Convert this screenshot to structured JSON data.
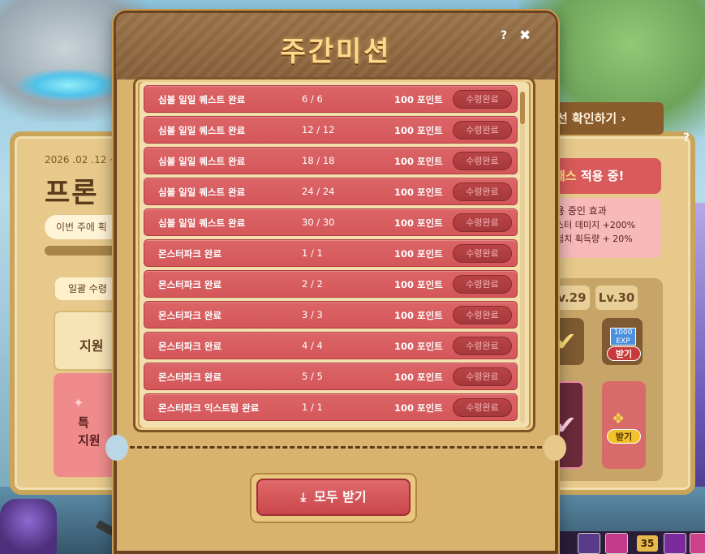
{
  "background": {
    "date": "2026 .02 .12 ~ 2",
    "title": "프론",
    "subtitle": "이번 주에 획",
    "tab_label": "일괄 수령",
    "card1": "지원 ",
    "card2_line1": "특",
    "card2_line2": "지원 ",
    "right_link": "선 확인하기 ›",
    "pass_highlight": "패스",
    "pass_rest": " 적용 중!",
    "effect_title": "용 중인 효과",
    "effect_line1": "스터 데미지 +200%",
    "effect_line2": "험치 획득량 + 20%",
    "lv29": "v.29",
    "lv30": "Lv.30",
    "exp_amount": "1000",
    "exp_label": "EXP",
    "get_label": "받기",
    "hud_level": "35",
    "help": "?"
  },
  "modal": {
    "title": "주간미션",
    "help_icon": "?",
    "close_icon": "✖",
    "claim_all_label": "모두 받기",
    "missions": [
      {
        "name": "심볼 일일 퀘스트 완료",
        "progress": "6 / 6",
        "points": "100 포인트",
        "status": "수령완료"
      },
      {
        "name": "심볼 일일 퀘스트 완료",
        "progress": "12 / 12",
        "points": "100 포인트",
        "status": "수령완료"
      },
      {
        "name": "심볼 일일 퀘스트 완료",
        "progress": "18 / 18",
        "points": "100 포인트",
        "status": "수령완료"
      },
      {
        "name": "심볼 일일 퀘스트 완료",
        "progress": "24 / 24",
        "points": "100 포인트",
        "status": "수령완료"
      },
      {
        "name": "심볼 일일 퀘스트 완료",
        "progress": "30 / 30",
        "points": "100 포인트",
        "status": "수령완료"
      },
      {
        "name": "몬스터파크 완료",
        "progress": "1 / 1",
        "points": "100 포인트",
        "status": "수령완료"
      },
      {
        "name": "몬스터파크 완료",
        "progress": "2 / 2",
        "points": "100 포인트",
        "status": "수령완료"
      },
      {
        "name": "몬스터파크 완료",
        "progress": "3 / 3",
        "points": "100 포인트",
        "status": "수령완료"
      },
      {
        "name": "몬스터파크 완료",
        "progress": "4 / 4",
        "points": "100 포인트",
        "status": "수령완료"
      },
      {
        "name": "몬스터파크 완료",
        "progress": "5 / 5",
        "points": "100 포인트",
        "status": "수령완료"
      },
      {
        "name": "몬스터파크 익스트림 완료",
        "progress": "1 / 1",
        "points": "100 포인트",
        "status": "수령완료"
      }
    ]
  },
  "colors": {
    "row_red": "#d85e61",
    "title_gold": "#ffd98a",
    "frame_brown": "#6a4421"
  }
}
